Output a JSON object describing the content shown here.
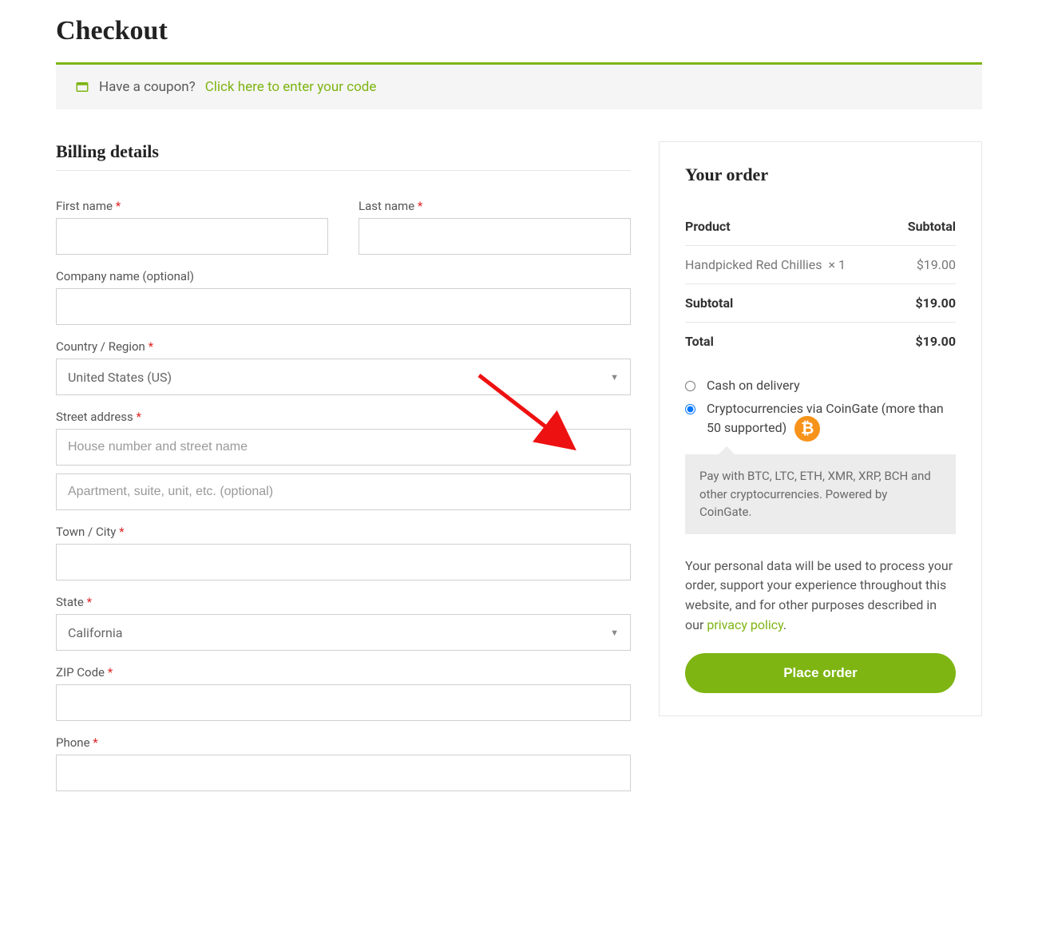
{
  "page": {
    "title": "Checkout"
  },
  "notice": {
    "question": "Have a coupon?",
    "link_text": "Click here to enter your code"
  },
  "billing": {
    "heading": "Billing details",
    "labels": {
      "first_name": "First name",
      "last_name": "Last name",
      "company": "Company name (optional)",
      "country": "Country / Region",
      "street": "Street address",
      "city": "Town / City",
      "state": "State",
      "zip": "ZIP Code",
      "phone": "Phone"
    },
    "placeholders": {
      "street1": "House number and street name",
      "street2": "Apartment, suite, unit, etc. (optional)"
    },
    "values": {
      "country": "United States (US)",
      "state": "California"
    }
  },
  "order": {
    "heading": "Your order",
    "columns": {
      "product": "Product",
      "subtotal": "Subtotal"
    },
    "items": [
      {
        "name": "Handpicked Red Chillies",
        "qty": "× 1",
        "price": "$19.00"
      }
    ],
    "subtotal_label": "Subtotal",
    "subtotal_value": "$19.00",
    "total_label": "Total",
    "total_value": "$19.00"
  },
  "payment": {
    "cod_label": "Cash on delivery",
    "coingate_label": "Cryptocurrencies via CoinGate (more than 50 supported)",
    "coingate_desc": "Pay with BTC, LTC, ETH, XMR, XRP, BCH and other cryptocurrencies. Powered by CoinGate."
  },
  "privacy": {
    "text_before": "Your personal data will be used to process your order, support your experience throughout this website, and for other purposes described in our ",
    "link": "privacy policy",
    "text_after": "."
  },
  "buttons": {
    "place_order": "Place order"
  }
}
